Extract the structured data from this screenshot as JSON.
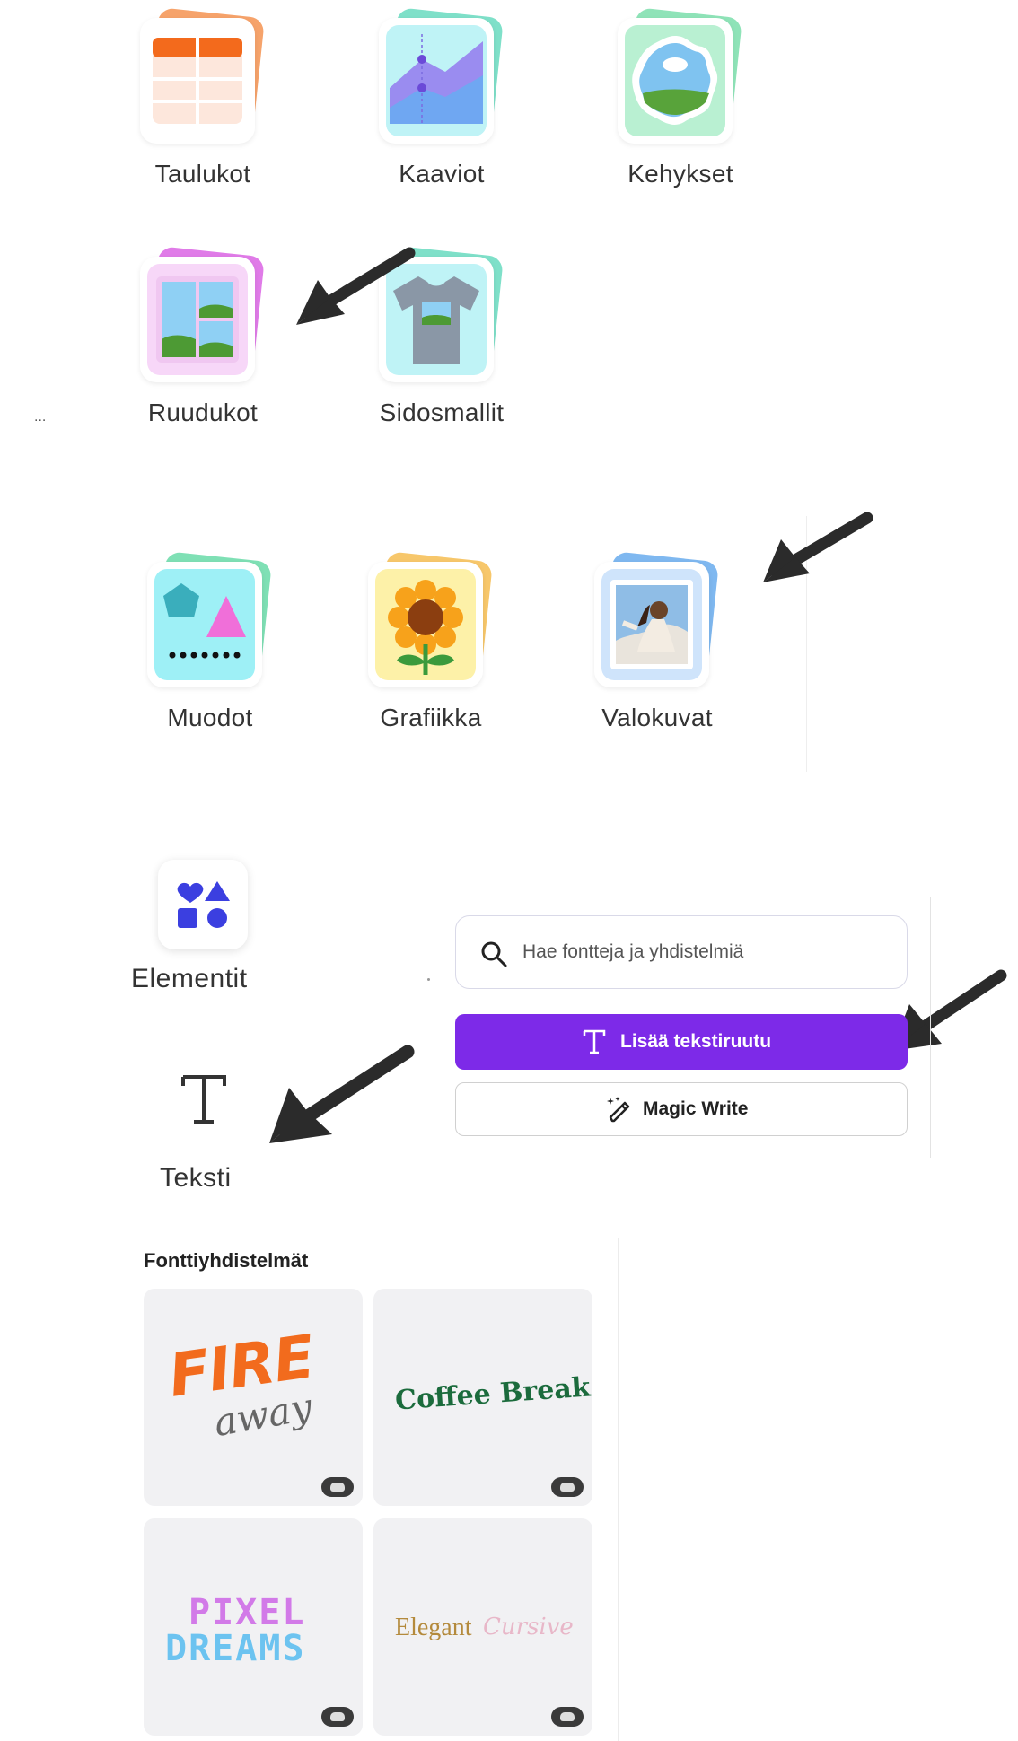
{
  "categories_row1": [
    {
      "label": "Taulukot",
      "icon": "table-icon"
    },
    {
      "label": "Kaaviot",
      "icon": "chart-icon"
    },
    {
      "label": "Kehykset",
      "icon": "frame-icon"
    }
  ],
  "categories_row2": [
    {
      "label": "Ruudukot",
      "icon": "grid-icon"
    },
    {
      "label": "Sidosmallit",
      "icon": "tshirt-mockup-icon"
    }
  ],
  "categories_row3": [
    {
      "label": "Muodot",
      "icon": "shapes-icon"
    },
    {
      "label": "Grafiikka",
      "icon": "sunflower-icon"
    },
    {
      "label": "Valokuvat",
      "icon": "photo-icon"
    }
  ],
  "ellipsis": "...",
  "sidebar": {
    "elements_label": "Elementit",
    "text_label": "Teksti"
  },
  "text_panel": {
    "search_placeholder": "Hae fontteja ja yhdistelmiä",
    "add_textbox_label": "Lisää tekstiruutu",
    "magic_write_label": "Magic Write"
  },
  "font_combos": {
    "title": "Fonttiyhdistelmät",
    "items": [
      {
        "line1": "FIRE",
        "line2": "away"
      },
      {
        "line1": "Coffee Break",
        "line2": ""
      },
      {
        "line1": "PIXEL",
        "line2": "DREAMS"
      },
      {
        "line1": "Elegant",
        "line2": "Cursive"
      }
    ]
  },
  "colors": {
    "primary": "#7d2ae8",
    "arrow": "#2b2b2b"
  }
}
